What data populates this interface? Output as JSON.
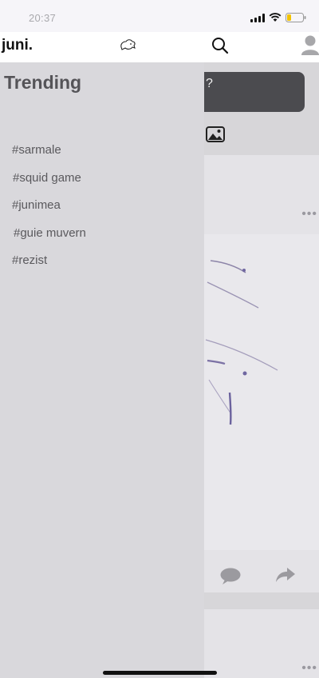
{
  "status_bar": {
    "time": "20:37"
  },
  "nav": {
    "brand": "juni."
  },
  "drawer": {
    "title": "Trending",
    "items": [
      "#sarmale",
      "#squid game",
      "#junimea",
      "#guie muvern",
      "#rezist"
    ]
  },
  "feed": {
    "composer_placeholder": "?",
    "more_label": "•••"
  },
  "colors": {
    "drawer_bg": "#d9d8dc",
    "nav_bg": "#ffffff",
    "composer_bg": "#4b4b4f"
  }
}
